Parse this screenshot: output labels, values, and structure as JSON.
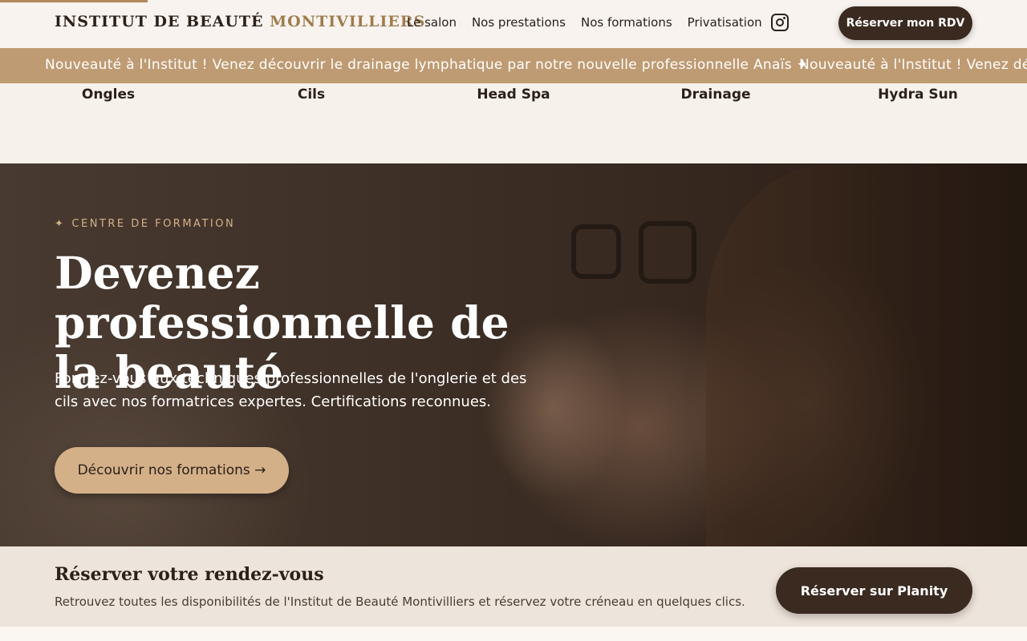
{
  "header": {
    "logo_part1": "INSTITUT DE BEAUTÉ",
    "logo_part2": "MONTIVILLIERS",
    "nav": [
      "Le salon",
      "Nos prestations",
      "Nos formations",
      "Privatisation"
    ],
    "instagram_icon": "instagram-icon",
    "cta": "Réserver mon RDV"
  },
  "marquee": {
    "text": "Nouveauté à l'Institut ! Venez découvrir le drainage lymphatique par notre nouvelle professionnelle Anaïs  ✦",
    "text_repeat": "Nouveauté à l'Institut ! Venez décou"
  },
  "categories": [
    "Ongles",
    "Cils",
    "Head Spa",
    "Drainage",
    "Hydra Sun"
  ],
  "hero": {
    "eyebrow_icon": "✦",
    "eyebrow": "CENTRE DE FORMATION",
    "title": "Devenez professionnelle de la beauté",
    "subtitle": "Formez-vous aux techniques professionnelles de l'onglerie et des cils avec nos formatrices expertes. Certifications reconnues.",
    "cta": "Découvrir nos formations →"
  },
  "booking": {
    "title": "Réserver votre rendez-vous",
    "subtitle": "Retrouvez toutes les disponibilités de l'Institut de Beauté Montivilliers et réservez votre créneau en quelques clics.",
    "cta": "Réserver sur Planity"
  },
  "colors": {
    "accent": "#bf9b73",
    "dark": "#3a2a20",
    "gold_text": "#a07c4e"
  }
}
